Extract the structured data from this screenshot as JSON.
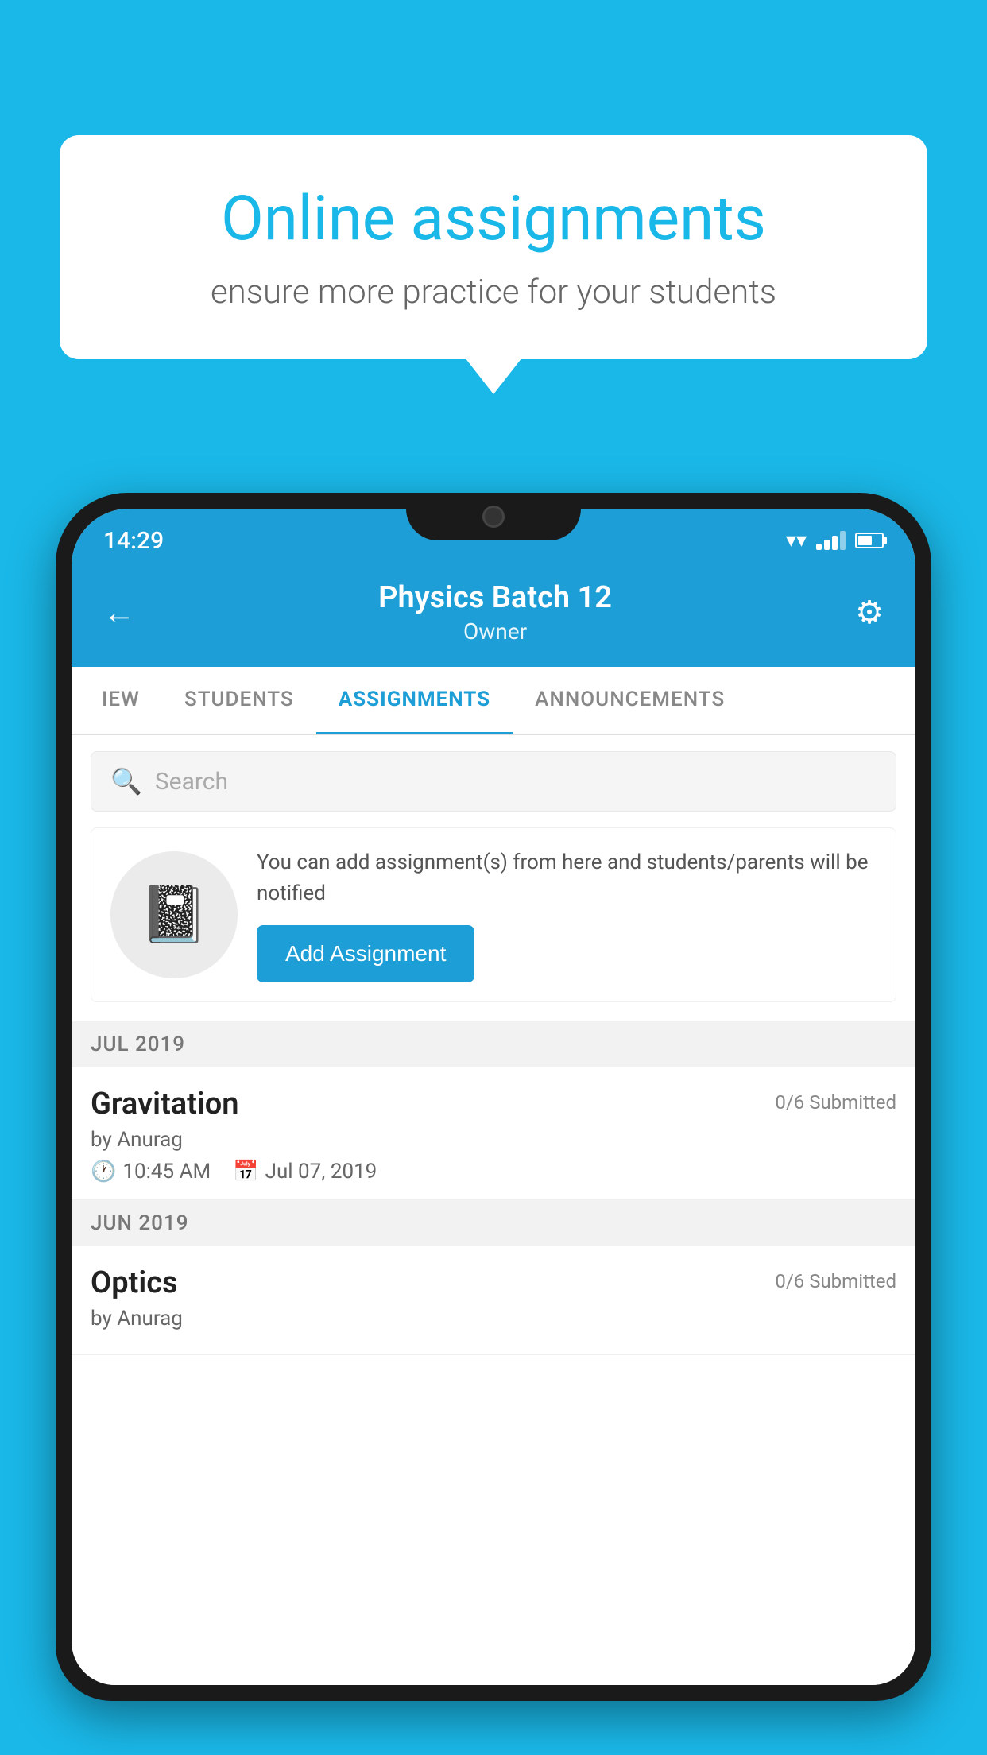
{
  "background": {
    "color": "#1ab8e8"
  },
  "speech_bubble": {
    "title": "Online assignments",
    "subtitle": "ensure more practice for your students"
  },
  "status_bar": {
    "time": "14:29"
  },
  "app_header": {
    "title": "Physics Batch 12",
    "subtitle": "Owner",
    "back_label": "←",
    "settings_label": "⚙"
  },
  "tabs": [
    {
      "label": "IEW",
      "active": false
    },
    {
      "label": "STUDENTS",
      "active": false
    },
    {
      "label": "ASSIGNMENTS",
      "active": true
    },
    {
      "label": "ANNOUNCEMENTS",
      "active": false
    }
  ],
  "search": {
    "placeholder": "Search"
  },
  "promo_card": {
    "text": "You can add assignment(s) from here and students/parents will be notified",
    "button_label": "Add Assignment"
  },
  "assignment_sections": [
    {
      "month": "JUL 2019",
      "items": [
        {
          "title": "Gravitation",
          "submitted": "0/6 Submitted",
          "author": "by Anurag",
          "time": "10:45 AM",
          "date": "Jul 07, 2019"
        }
      ]
    },
    {
      "month": "JUN 2019",
      "items": [
        {
          "title": "Optics",
          "submitted": "0/6 Submitted",
          "author": "by Anurag",
          "time": "",
          "date": ""
        }
      ]
    }
  ]
}
